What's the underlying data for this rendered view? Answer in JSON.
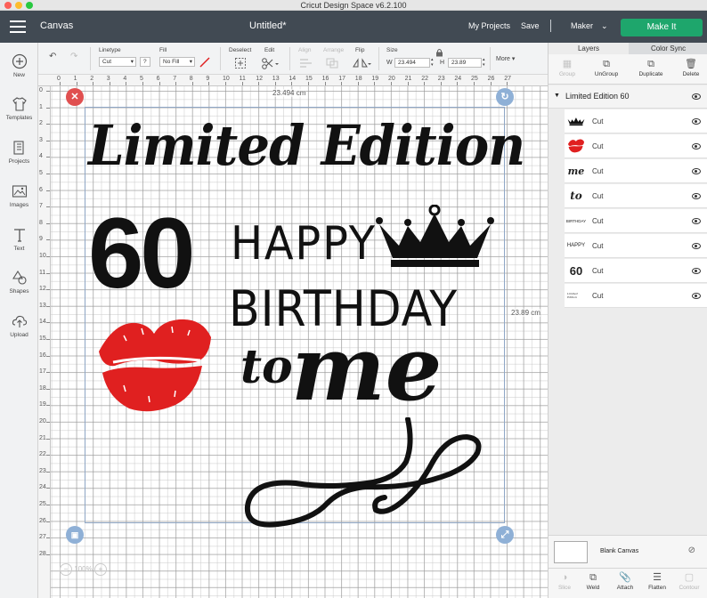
{
  "window": {
    "title": "Cricut Design Space  v6.2.100"
  },
  "header": {
    "app_name": "Canvas",
    "doc_title": "Untitled*",
    "my_projects": "My Projects",
    "save": "Save",
    "machine": "Maker",
    "make_it": "Make It",
    "colors": {
      "bar": "#414a53",
      "make_it": "#1ea66c"
    }
  },
  "toolbar": {
    "linetype_label": "Linetype",
    "linetype_value": "Cut",
    "linetype_help": "?",
    "fill_label": "Fill",
    "fill_value": "No Fill",
    "deselect_label": "Deselect",
    "edit_label": "Edit",
    "align_label": "Align",
    "arrange_label": "Arrange",
    "flip_label": "Flip",
    "size_label": "Size",
    "w_label": "W",
    "w_value": "23.494",
    "h_label": "H",
    "h_value": "23.89",
    "more_label": "More"
  },
  "sidebar": {
    "items": [
      {
        "label": "New",
        "icon": "plus-icon"
      },
      {
        "label": "Templates",
        "icon": "shirt-icon"
      },
      {
        "label": "Projects",
        "icon": "projects-icon"
      },
      {
        "label": "Images",
        "icon": "image-icon"
      },
      {
        "label": "Text",
        "icon": "text-icon"
      },
      {
        "label": "Shapes",
        "icon": "shapes-icon"
      },
      {
        "label": "Upload",
        "icon": "upload-icon"
      }
    ]
  },
  "rulers": {
    "h_ticks": [
      "0",
      "1",
      "2",
      "3",
      "4",
      "5",
      "6",
      "7",
      "8",
      "9",
      "10",
      "11",
      "12",
      "13",
      "14",
      "15",
      "16",
      "17",
      "18",
      "19",
      "20",
      "21",
      "22",
      "23",
      "24",
      "25",
      "26",
      "27"
    ],
    "v_ticks": [
      "0",
      "1",
      "2",
      "3",
      "4",
      "5",
      "6",
      "7",
      "8",
      "9",
      "10",
      "11",
      "12",
      "13",
      "14",
      "15",
      "16",
      "17",
      "18",
      "19",
      "20",
      "21",
      "22",
      "23",
      "24",
      "25",
      "26",
      "27",
      "28"
    ]
  },
  "canvas": {
    "width_label": "23.494 cm",
    "height_label": "23.89 cm",
    "zoom": "100%",
    "art": {
      "line1": "Limited Edition",
      "number": "60",
      "happy": "HAPPY",
      "birthday": "BIRTHDAY",
      "to": "to",
      "me": "me"
    },
    "colors": {
      "lips": "#e02020",
      "selection": "#8fa7c6",
      "delete_handle": "#e05050",
      "blue_handle": "#8fb0d6"
    }
  },
  "layers_panel": {
    "tabs": [
      "Layers",
      "Color Sync"
    ],
    "actions": [
      "Group",
      "UnGroup",
      "Duplicate",
      "Delete"
    ],
    "group_name": "Limited Edition 60",
    "layers": [
      {
        "name": "Cut",
        "thumb": "crown"
      },
      {
        "name": "Cut",
        "thumb": "lips"
      },
      {
        "name": "Cut",
        "thumb": "me"
      },
      {
        "name": "Cut",
        "thumb": "to"
      },
      {
        "name": "Cut",
        "thumb": "birthday"
      },
      {
        "name": "Cut",
        "thumb": "happy"
      },
      {
        "name": "Cut",
        "thumb": "60"
      },
      {
        "name": "Cut",
        "thumb": "limited"
      }
    ],
    "blank_canvas": "Blank Canvas",
    "bottom_actions": [
      "Slice",
      "Weld",
      "Attach",
      "Flatten",
      "Contour"
    ]
  }
}
